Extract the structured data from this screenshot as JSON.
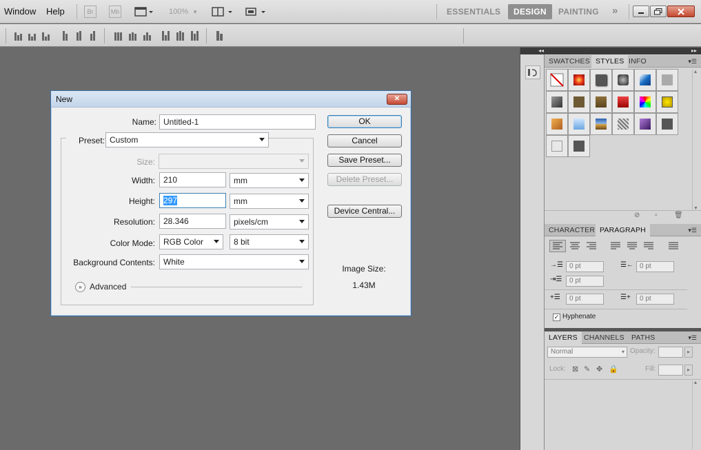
{
  "menubar": {
    "items": [
      "Window",
      "Help"
    ],
    "app_icons": [
      "Br",
      "Mb"
    ],
    "zoom": "100%",
    "workspaces": [
      "ESSENTIALS",
      "DESIGN",
      "PAINTING"
    ],
    "more": "»",
    "active_workspace": "DESIGN"
  },
  "dialog": {
    "title": "New",
    "close": "✕",
    "name_label": "Name:",
    "name_value": "Untitled-1",
    "preset_label": "Preset:",
    "preset_value": "Custom",
    "size_label": "Size:",
    "size_value": "",
    "width_label": "Width:",
    "width_value": "210",
    "width_unit": "mm",
    "height_label": "Height:",
    "height_value": "297",
    "height_unit": "mm",
    "resolution_label": "Resolution:",
    "resolution_value": "28.346",
    "resolution_unit": "pixels/cm",
    "color_mode_label": "Color Mode:",
    "color_mode_value": "RGB Color",
    "bit_depth_value": "8 bit",
    "background_label": "Background Contents:",
    "background_value": "White",
    "advanced_label": "Advanced",
    "buttons": {
      "ok": "OK",
      "cancel": "Cancel",
      "save_preset": "Save Preset...",
      "delete_preset": "Delete Preset...",
      "device_central": "Device Central..."
    },
    "image_size_label": "Image Size:",
    "image_size_value": "1.43M"
  },
  "panels": {
    "styles_tabs": [
      "SWATCHES",
      "STYLES",
      "INFO"
    ],
    "styles_selected": "STYLES",
    "char_tabs": [
      "CHARACTER",
      "PARAGRAPH"
    ],
    "char_selected": "PARAGRAPH",
    "indent_values": [
      "0 pt",
      "0 pt",
      "0 pt",
      "0 pt",
      "0 pt"
    ],
    "hyphenate_label": "Hyphenate",
    "hyphenate_checked": true,
    "layers_tabs": [
      "LAYERS",
      "CHANNELS",
      "PATHS"
    ],
    "layers_selected": "LAYERS",
    "blend_mode": "Normal",
    "opacity_label": "Opacity:",
    "lock_label": "Lock:",
    "fill_label": "Fill:"
  },
  "colors": {
    "accent": "#3a6ea5",
    "workspace_active": "#8f8f8f"
  }
}
